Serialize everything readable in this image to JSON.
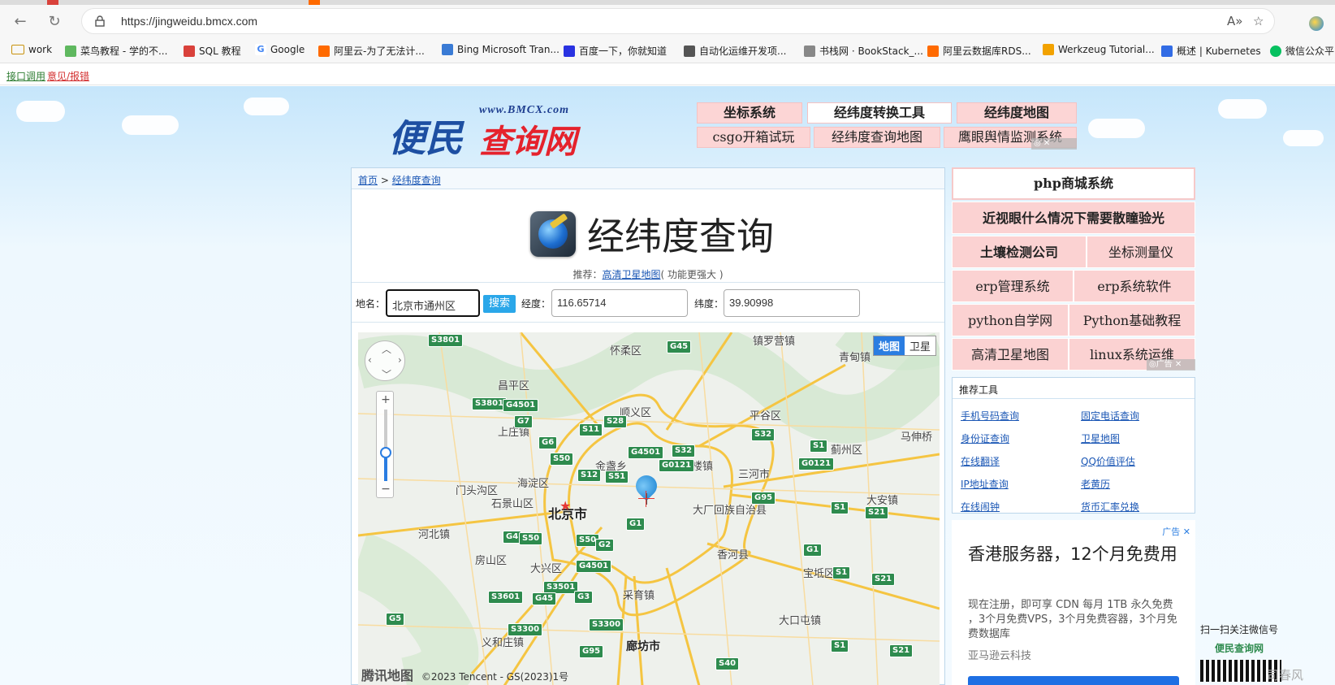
{
  "browser": {
    "url": "https://jingweidu.bmcx.com",
    "bookmarks": [
      {
        "label": "work",
        "color": "#f2b233"
      },
      {
        "label": "菜鸟教程 - 学的不...",
        "color": "#5fb85f"
      },
      {
        "label": "SQL 教程",
        "color": "#d9413b"
      },
      {
        "label": "Google",
        "color": "#4285f4"
      },
      {
        "label": "阿里云-为了无法计...",
        "color": "#ff6a00"
      },
      {
        "label": "Bing Microsoft Tran...",
        "color": "#3a7bd5"
      },
      {
        "label": "百度一下，你就知道",
        "color": "#2932e1"
      },
      {
        "label": "自动化运维开发项...",
        "color": "#555555"
      },
      {
        "label": "书栈网 · BookStack_...",
        "color": "#888888"
      },
      {
        "label": "阿里云数据库RDS...",
        "color": "#ff6a00"
      },
      {
        "label": "Werkzeug Tutorial...",
        "color": "#f2a200"
      },
      {
        "label": "概述 | Kubernetes",
        "color": "#326ce5"
      },
      {
        "label": "微信公众平",
        "color": "#07c160"
      }
    ]
  },
  "toplinks": {
    "api": "接口调用",
    "feedback": "意见/报错"
  },
  "logo": {
    "caption": "www.BMCX.com",
    "part1": "便民",
    "part2": "查询网"
  },
  "topnav": {
    "row1": [
      "坐标系统",
      "经纬度转换工具",
      "经纬度地图"
    ],
    "row2": [
      "csgo开箱试玩",
      "经纬度查询地图",
      "鹰眼舆情监测系统"
    ]
  },
  "breadcrumb": {
    "home": "首页",
    "sep": ">",
    "current": "经纬度查询"
  },
  "page": {
    "title": "经纬度查询",
    "rec_prefix": "推荐：",
    "rec_link": "高清卫星地图",
    "rec_suffix": "( 功能更强大 )"
  },
  "search": {
    "place_label": "地名：",
    "place_value": "北京市通州区",
    "button": "搜索",
    "lng_label": "经度：",
    "lng_value": "116.65714",
    "lat_label": "纬度：",
    "lat_value": "39.90998"
  },
  "map": {
    "type_map": "地图",
    "type_sat": "卫星",
    "brand": "腾讯地图",
    "copyright": "©2023 Tencent - GS(2023)1号",
    "places": [
      "怀柔区",
      "镇罗营镇",
      "昌平区",
      "顺义区",
      "平谷区",
      "青甸镇",
      "马伸桥",
      "上庄镇",
      "金盏乡",
      "高楼镇",
      "蓟州区",
      "海淀区",
      "三河市",
      "门头沟区",
      "石景山区",
      "北京市",
      "大厂回族自治县",
      "大安镇",
      "河北镇",
      "房山区",
      "香河县",
      "大兴区",
      "宝坻区",
      "采育镇",
      "大口屯镇",
      "义和庄镇",
      "廊坊市"
    ],
    "shields": [
      "S3801",
      "G45",
      "S3801",
      "G4501",
      "G7",
      "S28",
      "S11",
      "G6",
      "G4501",
      "S32",
      "S32",
      "S1",
      "G0121",
      "S50",
      "G0121",
      "S12",
      "S51",
      "G95",
      "S1",
      "S21",
      "G4",
      "S50",
      "S50",
      "G2",
      "G1",
      "G1",
      "S1",
      "G4501",
      "S3501",
      "S21",
      "S3601",
      "G45",
      "G3",
      "G5",
      "S3300",
      "S3300",
      "S1",
      "G95",
      "S40",
      "S21"
    ]
  },
  "side": {
    "grid": [
      {
        "label": "php商城系统"
      },
      {
        "label": "近视眼什么情况下需要散瞳验光"
      },
      {
        "label": "土壤检测公司"
      },
      {
        "label": "坐标测量仪"
      },
      {
        "label": "erp管理系统"
      },
      {
        "label": "erp系统软件"
      },
      {
        "label": "python自学网"
      },
      {
        "label": "Python基础教程"
      },
      {
        "label": "高清卫星地图"
      },
      {
        "label": "linux系统运维"
      }
    ],
    "ad_tag": "广告",
    "tools_title": "推荐工具",
    "tools": [
      "手机号码查询",
      "固定电话查询",
      "身份证查询",
      "卫星地图",
      "在线翻译",
      "QQ价值评估",
      "IP地址查询",
      "老黄历",
      "在线闹钟",
      "货币汇率兑换"
    ],
    "ad2": {
      "tag": "广告",
      "title": "香港服务器，12个月免费用",
      "desc": "现在注册，即可享 CDN 每月 1TB 永久免费 ，3个月免费VPS，3个月免费容器，3个月免费数据库",
      "company": "亚马逊云科技"
    }
  },
  "qr": {
    "line1": "扫一扫关注微信号",
    "line2": "便民查询网"
  },
  "watermark": "司春风"
}
